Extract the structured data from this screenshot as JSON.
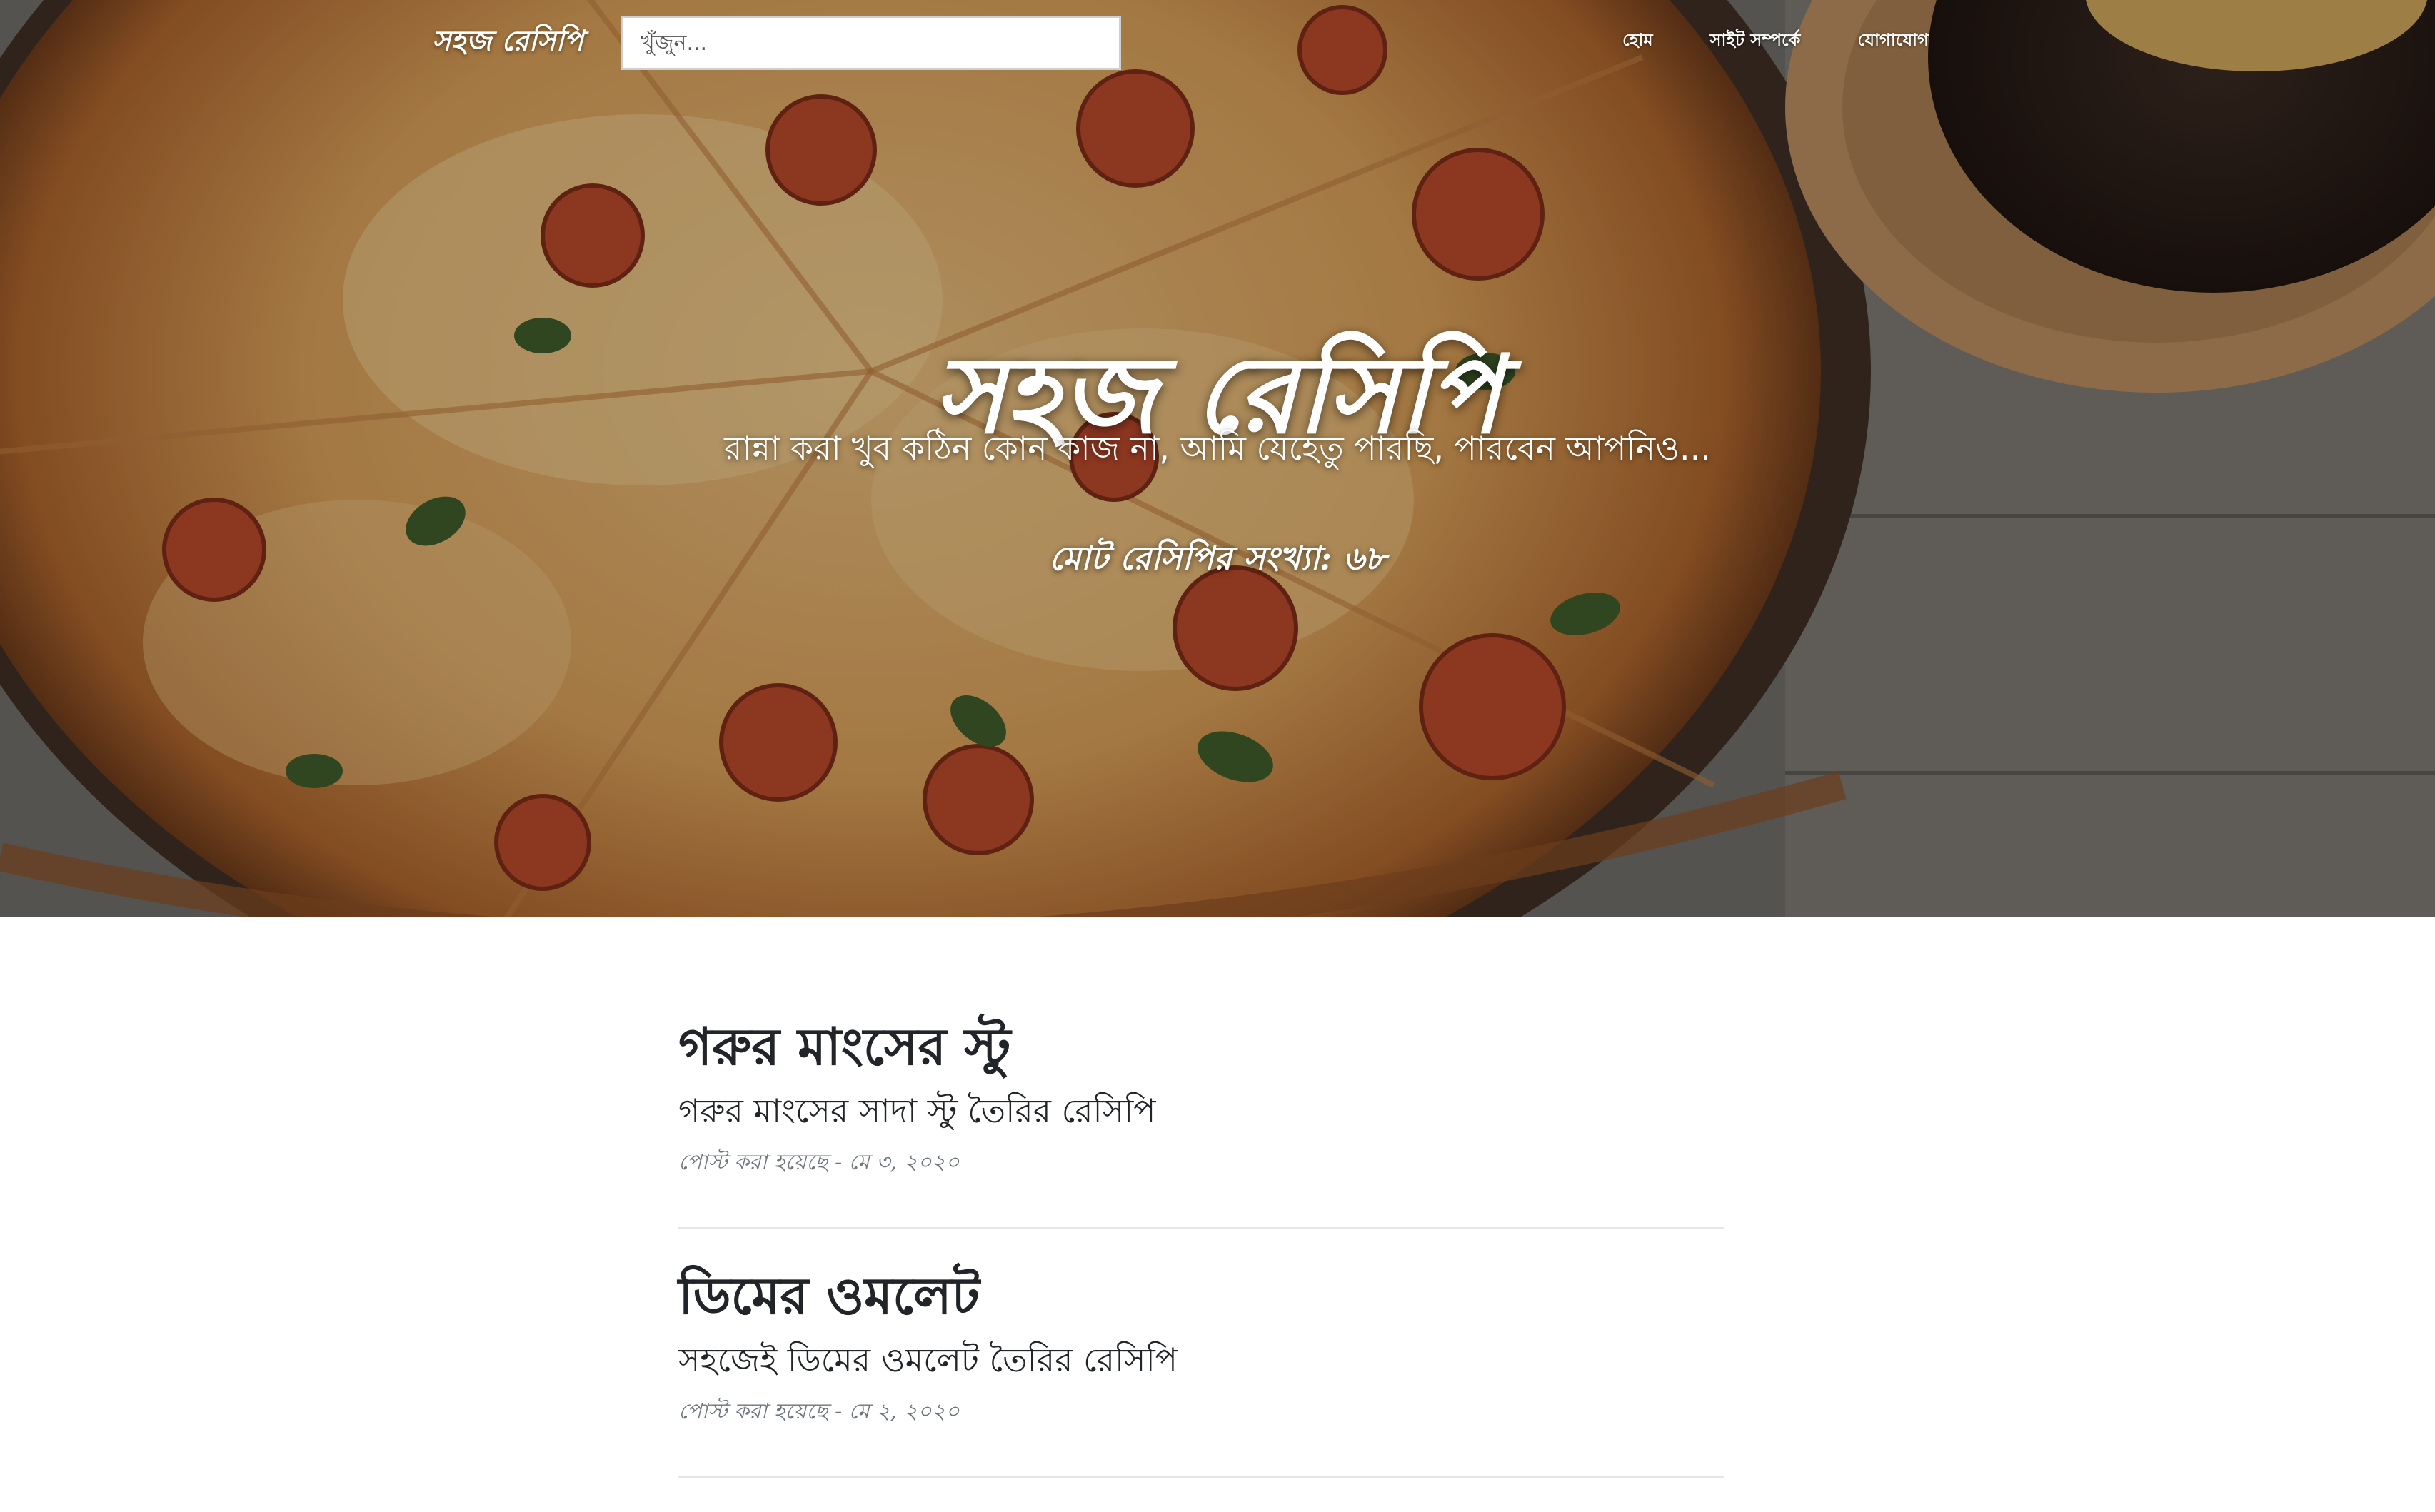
{
  "nav": {
    "brand": "সহজ রেসিপি",
    "search_placeholder": "খুঁজুন...",
    "links": [
      "হোম",
      "সাইট সম্পর্কে",
      "যোগাযোগ"
    ]
  },
  "hero": {
    "title": "সহজ রেসিপি",
    "subtitle": "রান্না করা খুব কঠিন কোন কাজ না, আমি যেহেতু পারছি, পারবেন আপনিও...",
    "recipe_count": "মোট রেসিপির সংখ্যা: ৬৮"
  },
  "posts": [
    {
      "title": "গরুর মাংসের স্টু",
      "subtitle": "গরুর মাংসের সাদা স্টু তৈরির রেসিপি",
      "meta": "পোস্ট করা হয়েছে - মে ৩, ২০২০"
    },
    {
      "title": "ডিমের ওমলেট",
      "subtitle": "সহজেই ডিমের ওমলেট তৈরির রেসিপি",
      "meta": "পোস্ট করা হয়েছে - মে ২, ২০২০"
    }
  ],
  "colors": {
    "text_dark": "#212529",
    "meta_gray": "#6c757d",
    "divider": "#e6e6e6"
  }
}
